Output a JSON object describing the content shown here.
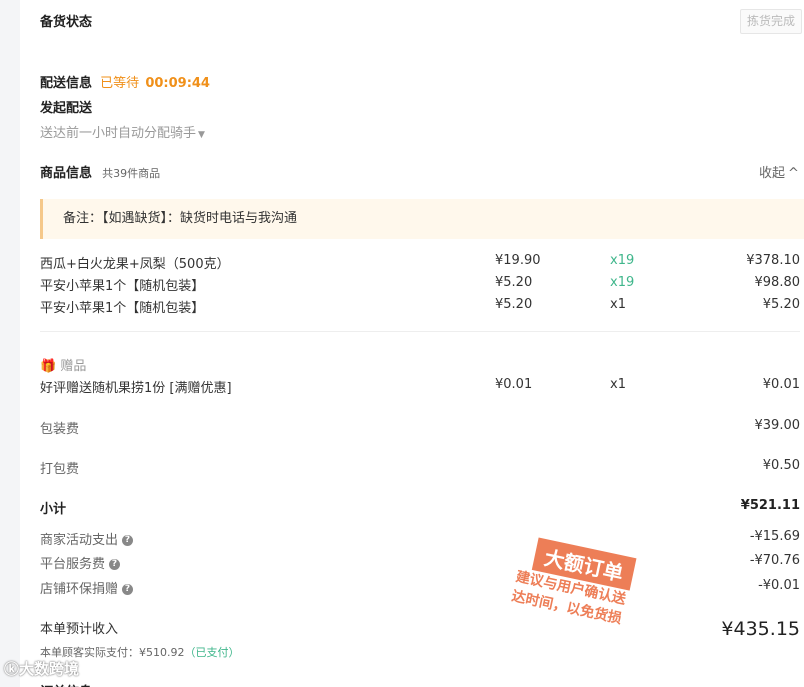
{
  "header": {
    "title": "备货状态",
    "pick_button": "拣货完成"
  },
  "delivery": {
    "label": "配送信息",
    "status": "已等待",
    "timer": "00:09:44",
    "dispatch_title": "发起配送",
    "dispatch_select": "送达前一小时自动分配骑手"
  },
  "products": {
    "title": "商品信息",
    "count": "共39件商品",
    "collapse": "收起",
    "note": "备注：【如遇缺货】：缺货时电话与我沟通",
    "items": [
      {
        "name": "西瓜+白火龙果+凤梨（500克）",
        "price": "¥19.90",
        "qty": "x19",
        "total": "¥378.10"
      },
      {
        "name": "平安小苹果1个【随机包装】",
        "price": "¥5.20",
        "qty": "x19",
        "total": "¥98.80"
      },
      {
        "name": "平安小苹果1个【随机包装】",
        "price": "¥5.20",
        "qty": "x1",
        "total": "¥5.20"
      }
    ]
  },
  "gift": {
    "label": "赠品",
    "name": "好评赠送随机果捞1份 [满赠优惠]",
    "price": "¥0.01",
    "qty": "x1",
    "total": "¥0.01"
  },
  "fees": {
    "packaging_label": "包装费",
    "packaging_value": "¥39.00",
    "packing_label": "打包费",
    "packing_value": "¥0.50"
  },
  "summary": {
    "subtotal_label": "小计",
    "subtotal_value": "¥521.11",
    "activity_label": "商家活动支出",
    "activity_value": "-¥15.69",
    "platform_label": "平台服务费",
    "platform_value": "-¥70.76",
    "eco_label": "店铺环保捐赠",
    "eco_value": "-¥0.01",
    "income_label": "本单预计收入",
    "income_value": "¥435.15",
    "paid_text": "本单顾客实际支付：¥510.92",
    "paid_status": "（已支付）"
  },
  "stamp": {
    "title": "大额订单",
    "line1": "建议与用户确认送",
    "line2": "达时间，以免货损"
  },
  "watermark": "大数跨境",
  "colors": {
    "accent": "#f0901a",
    "green": "#3fb68b",
    "stamp": "#e8531f"
  }
}
